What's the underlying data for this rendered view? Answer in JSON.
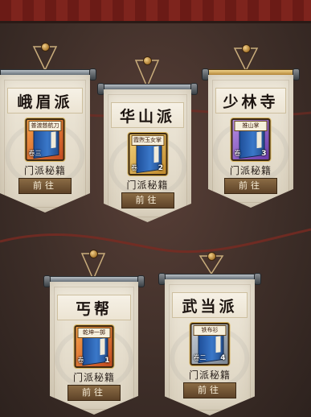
{
  "sects": [
    {
      "id": "emei",
      "name": "峨眉派",
      "skill": "普渡慈航刀",
      "volume_label": "卷",
      "volume_num": "三",
      "rarity": "orange",
      "subtitle": "门派秘籍",
      "button": "前往"
    },
    {
      "id": "huashan",
      "name": "华山派",
      "skill": "霞煦玉女掌",
      "volume_label": "卷",
      "volume_num": "2",
      "rarity": "gold",
      "subtitle": "门派秘籍",
      "button": "前往"
    },
    {
      "id": "shaolin",
      "name": "少林寺",
      "skill": "推山掌",
      "volume_label": "卷",
      "volume_num": "3",
      "rarity": "purple",
      "subtitle": "门派秘籍",
      "button": "前往"
    },
    {
      "id": "gaibang",
      "name": "丐帮",
      "skill": "乾坤一掷",
      "volume_label": "卷",
      "volume_num": "1",
      "rarity": "orange",
      "subtitle": "门派秘籍",
      "button": "前往"
    },
    {
      "id": "wudang",
      "name": "武当派",
      "skill": "铁布衫",
      "volume_label": "卷二",
      "volume_num": "4",
      "rarity": "silver",
      "subtitle": "门派秘籍",
      "button": "前往"
    }
  ]
}
